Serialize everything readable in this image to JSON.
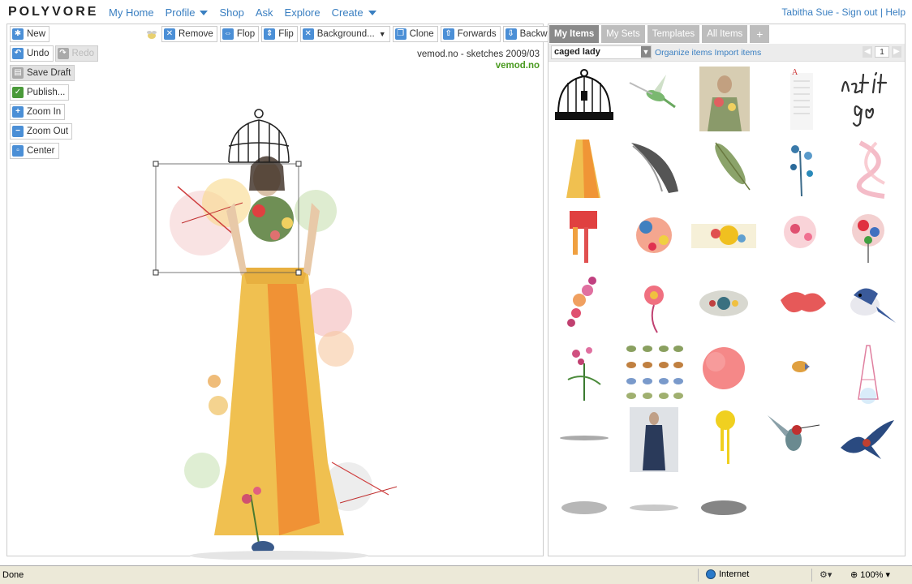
{
  "header": {
    "logo": "POLYVORE",
    "nav": [
      {
        "label": "My Home",
        "caret": false
      },
      {
        "label": "Profile",
        "caret": true
      },
      {
        "label": "Shop",
        "caret": false
      },
      {
        "label": "Ask",
        "caret": false
      },
      {
        "label": "Explore",
        "caret": false
      },
      {
        "label": "Create",
        "caret": true
      }
    ],
    "user": "Tabitha Sue",
    "sign_out": "Sign out",
    "help": "Help"
  },
  "left_tools": {
    "new": "New",
    "undo": "Undo",
    "redo": "Redo",
    "save_draft": "Save Draft",
    "publish": "Publish...",
    "zoom_in": "Zoom In",
    "zoom_out": "Zoom Out",
    "center": "Center"
  },
  "top_tools": {
    "remove": "Remove",
    "flop": "Flop",
    "flip": "Flip",
    "background": "Background...",
    "clone": "Clone",
    "forwards": "Forwards",
    "backwards": "Backwards"
  },
  "set": {
    "title": "vemod.no - sketches 2009/03",
    "author": "vemod.no"
  },
  "items_panel": {
    "tabs": [
      "My Items",
      "My Sets",
      "Templates",
      "All Items",
      "+"
    ],
    "active_tab": "My Items",
    "search_value": "caged lady",
    "organize": "Organize items",
    "import": "Import items",
    "page": "1"
  },
  "status": {
    "done": "Done",
    "zone": "Internet",
    "zoom": "100%"
  },
  "colors": {
    "link": "#3a7fc1",
    "accent_green": "#4a9a20",
    "tab_active": "#8a8a8a",
    "tab_inactive": "#bdbdbd"
  }
}
